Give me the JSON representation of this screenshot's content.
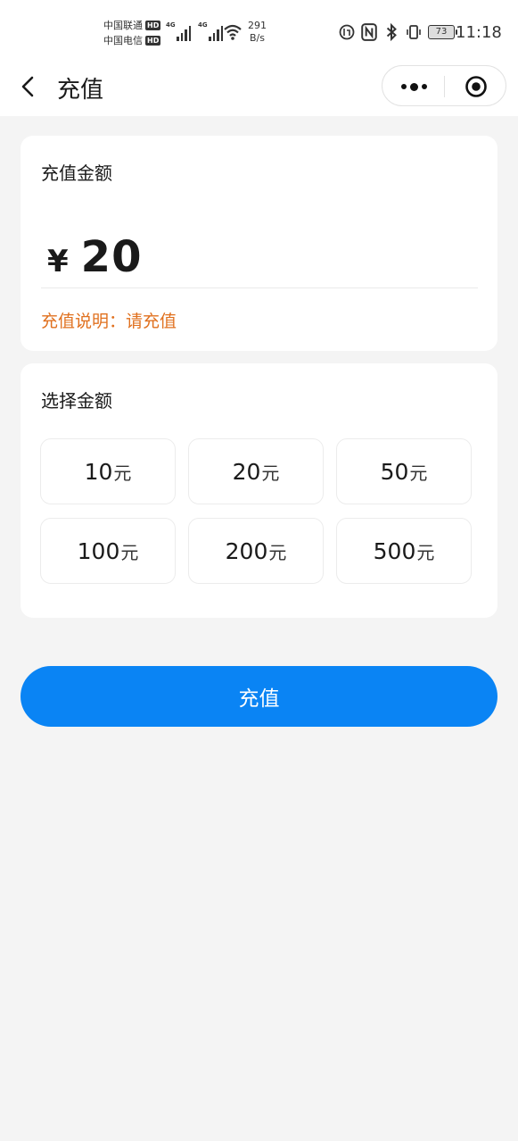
{
  "status_bar": {
    "carrier_1": "中国联通",
    "carrier_2": "中国电信",
    "hd_badge": "HD",
    "network_type": "4G",
    "speed_value": "291",
    "speed_unit": "B/s",
    "battery_level": "73",
    "time": "11:18",
    "icons": [
      "nfc-icon",
      "bluetooth-icon",
      "vibrate-icon",
      "data-saver-icon",
      "signal-icon",
      "wifi-icon",
      "battery-icon"
    ]
  },
  "nav": {
    "title": "充值",
    "icons": [
      "back-arrow-icon",
      "more-dots-icon",
      "close-target-icon"
    ]
  },
  "amount_card": {
    "label": "充值金额",
    "currency_symbol": "¥",
    "amount_value": "20",
    "note_label": "充值说明：",
    "note_value": "请充值"
  },
  "select_card": {
    "label": "选择金额",
    "unit": "元",
    "options": [
      "10",
      "20",
      "50",
      "100",
      "200",
      "500"
    ]
  },
  "submit_button": {
    "label": "充值"
  },
  "colors": {
    "accent": "#0a84f4",
    "note": "#e0701e",
    "background": "#f4f4f4"
  }
}
